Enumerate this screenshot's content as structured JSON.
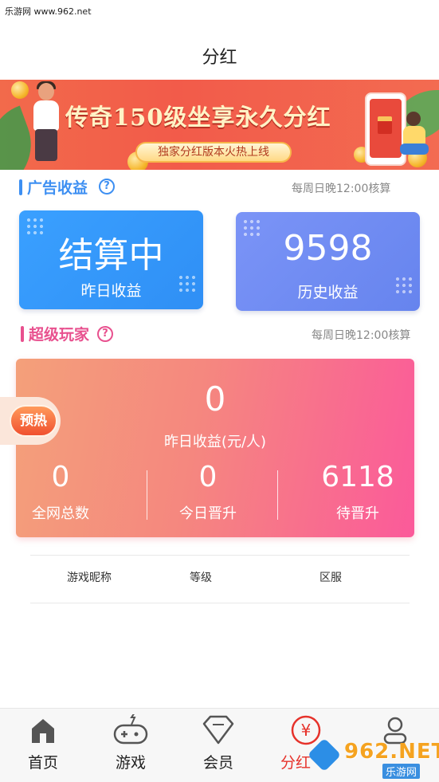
{
  "status_bar": {
    "watermark": "乐游网 www.962.net"
  },
  "header": {
    "title": "分红"
  },
  "banner": {
    "title": "传奇150级坐享永久分红",
    "subtitle": "独家分红版本火热上线"
  },
  "ad_income": {
    "title": "广告收益",
    "help": "?",
    "note": "每周日晚12:00核算",
    "cards": [
      {
        "value": "结算中",
        "label": "昨日收益",
        "color": "#3d9bff"
      },
      {
        "value": "9598",
        "label": "历史收益",
        "color": "#6f8ff5"
      }
    ]
  },
  "super_player": {
    "title": "超级玩家",
    "help": "?",
    "note": "每周日晚12:00核算",
    "badge": "预热",
    "main_value": "0",
    "main_label": "昨日收益(元/人)",
    "stats": [
      {
        "value": "0",
        "label": "全网总数"
      },
      {
        "value": "0",
        "label": "今日晋升"
      },
      {
        "value": "6118",
        "label": "待晋升"
      }
    ]
  },
  "table": {
    "columns": [
      "游戏昵称",
      "等级",
      "区服"
    ]
  },
  "nav": {
    "items": [
      {
        "label": "首页",
        "icon": "home-icon"
      },
      {
        "label": "游戏",
        "icon": "gamepad-icon"
      },
      {
        "label": "会员",
        "icon": "diamond-icon"
      },
      {
        "label": "分红",
        "icon": "yen-icon",
        "active": true
      },
      {
        "label": "",
        "icon": "user-icon"
      }
    ],
    "yen_symbol": "¥"
  },
  "watermark_bottom": {
    "text": "962.NET",
    "sub": "乐游网"
  },
  "colors": {
    "accent_red": "#e6322b",
    "ad_title": "#3d8ff2",
    "super_title": "#e8508e"
  }
}
